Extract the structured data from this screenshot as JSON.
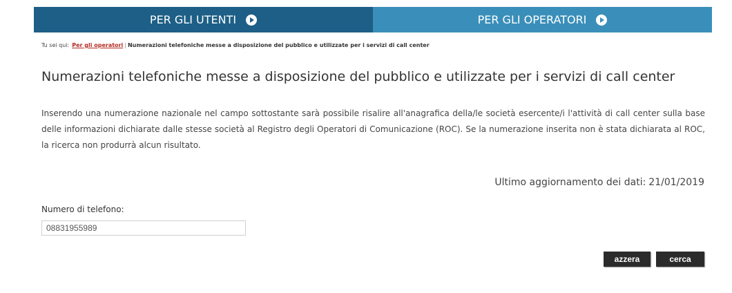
{
  "nav": {
    "tabs": [
      {
        "label": "PER GLI UTENTI",
        "icon": "arrow-right-circle-icon"
      },
      {
        "label": "PER GLI OPERATORI",
        "icon": "arrow-right-circle-icon"
      }
    ]
  },
  "breadcrumb": {
    "prefix": "Tu sei qui:",
    "link": "Per gli operatori",
    "separator": "|",
    "current": "Numerazioni telefoniche messe a disposizione del pubblico e utilizzate per i servizi di call center"
  },
  "page": {
    "title": "Numerazioni telefoniche messe a disposizione del pubblico e utilizzate per i servizi di call center",
    "description": "Inserendo una numerazione nazionale nel campo sottostante sarà possibile risalire all'anagrafica della/le società esercente/i l'attività di call center sulla base delle informazioni dichiarate dalle stesse società al Registro degli Operatori di Comunicazione (ROC). Se la numerazione inserita non è stata dichiarata al ROC, la ricerca non produrrà alcun risultato.",
    "updated_label": "Ultimo aggiornamento dei dati:",
    "updated_date": "21/01/2019"
  },
  "form": {
    "phone_label": "Numero di telefono:",
    "phone_value": "08831955989",
    "reset_label": "azzera",
    "search_label": "cerca"
  },
  "colors": {
    "tab_users": "#1d5f86",
    "tab_operators": "#3a8fba",
    "breadcrumb_link": "#b52a22",
    "button": "#2b2b2b"
  }
}
